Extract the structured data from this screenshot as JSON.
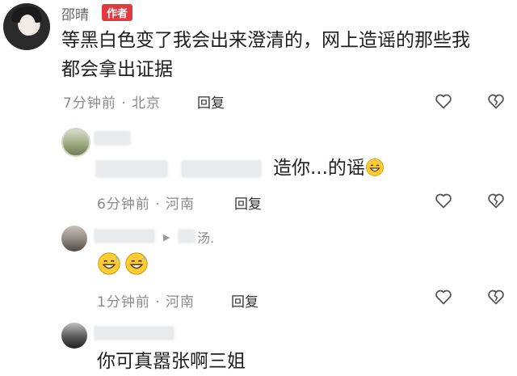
{
  "comments": [
    {
      "username": "邵晴",
      "badge": "作者",
      "text_line1": "等黑白色变了我会出来澄清的，网上造谣的那些我",
      "text_line2": "都会拿出证据",
      "meta": "7分钟前 · 北京",
      "reply_label": "回复"
    },
    {
      "username_visible": "",
      "text_suffix": "造你...的谣",
      "emoji": "grinning-sweat-emoji",
      "meta": "6分钟前 · 河南",
      "reply_label": "回复"
    },
    {
      "username_fragment": "汤.",
      "reply_marker": "▶",
      "emojis": [
        "grinning-sweat-emoji",
        "grinning-sweat-emoji"
      ],
      "meta": "1分钟前 · 河南",
      "reply_label": "回复"
    },
    {
      "text": "你可真嚣张啊三姐"
    }
  ],
  "icons": {
    "like": "heart-outline-icon",
    "dislike": "broken-heart-icon"
  },
  "colors": {
    "badge": "#e0393e",
    "meta": "#8a8a8a",
    "icon_stroke": "#555555"
  }
}
